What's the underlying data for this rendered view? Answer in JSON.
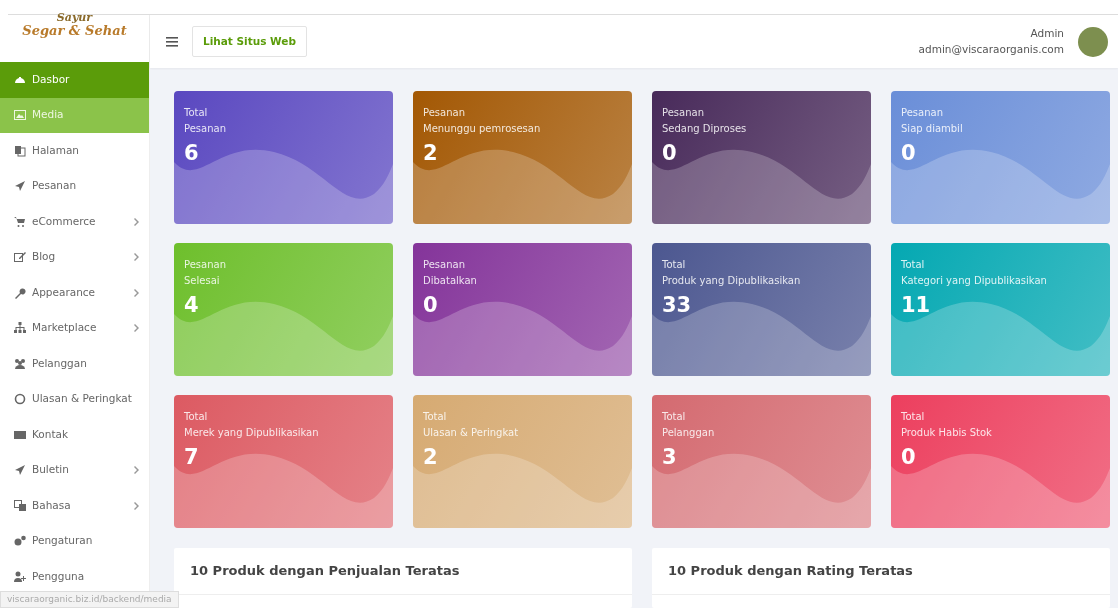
{
  "logo": {
    "line_1": "Sayur",
    "line_2": "Segar & Sehat"
  },
  "sidebar": {
    "items": [
      {
        "label": "Dasbor",
        "selected": true,
        "hovered": false,
        "has_submenu": false
      },
      {
        "label": "Media",
        "selected": false,
        "hovered": true,
        "has_submenu": false
      },
      {
        "label": "Halaman",
        "selected": false,
        "hovered": false,
        "has_submenu": false
      },
      {
        "label": "Pesanan",
        "selected": false,
        "hovered": false,
        "has_submenu": false
      },
      {
        "label": "eCommerce",
        "selected": false,
        "hovered": false,
        "has_submenu": true
      },
      {
        "label": "Blog",
        "selected": false,
        "hovered": false,
        "has_submenu": true
      },
      {
        "label": "Appearance",
        "selected": false,
        "hovered": false,
        "has_submenu": true
      },
      {
        "label": "Marketplace",
        "selected": false,
        "hovered": false,
        "has_submenu": true
      },
      {
        "label": "Pelanggan",
        "selected": false,
        "hovered": false,
        "has_submenu": false
      },
      {
        "label": "Ulasan & Peringkat",
        "selected": false,
        "hovered": false,
        "has_submenu": false
      },
      {
        "label": "Kontak",
        "selected": false,
        "hovered": false,
        "has_submenu": false
      },
      {
        "label": "Buletin",
        "selected": false,
        "hovered": false,
        "has_submenu": true
      },
      {
        "label": "Bahasa",
        "selected": false,
        "hovered": false,
        "has_submenu": true
      },
      {
        "label": "Pengaturan",
        "selected": false,
        "hovered": false,
        "has_submenu": false
      },
      {
        "label": "Pengguna",
        "selected": false,
        "hovered": false,
        "has_submenu": false
      }
    ]
  },
  "header": {
    "site_button": "Lihat Situs Web",
    "user_name": "Admin",
    "user_email": "admin@viscaraorganis.com"
  },
  "stat_cards": [
    {
      "line_1": "Total",
      "line_2": "Pesanan",
      "value": "6",
      "color": "#5a48c0"
    },
    {
      "line_1": "Pesanan",
      "line_2": "Menunggu pemrosesan",
      "value": "2",
      "color": "#a35804"
    },
    {
      "line_1": "Pesanan",
      "line_2": "Sedang Diproses",
      "value": "0",
      "color": "#482a5a"
    },
    {
      "line_1": "Pesanan",
      "line_2": "Siap diambil",
      "value": "0",
      "color": "#6a8ed8"
    },
    {
      "line_1": "Pesanan",
      "line_2": "Selesai",
      "value": "4",
      "color": "#6ebf2c"
    },
    {
      "line_1": "Pesanan",
      "line_2": "Dibatalkan",
      "value": "0",
      "color": "#84349a"
    },
    {
      "line_1": "Total",
      "line_2": "Produk yang Dipublikasikan",
      "value": "33",
      "color": "#4c5790"
    },
    {
      "line_1": "Total",
      "line_2": "Kategori yang Dipublikasikan",
      "value": "11",
      "color": "#04a8b2"
    },
    {
      "line_1": "Total",
      "line_2": "Merek yang Dipublikasikan",
      "value": "7",
      "color": "#dc5a62"
    },
    {
      "line_1": "Total",
      "line_2": "Ulasan & Peringkat",
      "value": "2",
      "color": "#d6aa72"
    },
    {
      "line_1": "Total",
      "line_2": "Pelanggan",
      "value": "3",
      "color": "#d46a70"
    },
    {
      "line_1": "Total",
      "line_2": "Produk Habis Stok",
      "value": "0",
      "color": "#ec3f5e"
    }
  ],
  "panels": [
    {
      "title": "10 Produk dengan Penjualan Teratas"
    },
    {
      "title": "10 Produk dengan Rating Teratas"
    }
  ],
  "status_url": "viscaraorganic.biz.id/backend/media"
}
